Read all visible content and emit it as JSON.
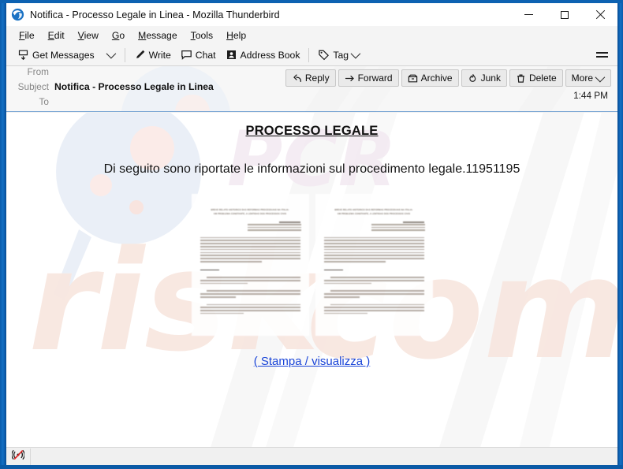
{
  "window": {
    "title": "Notifica - Processo Legale in Linea - Mozilla Thunderbird",
    "app_icon": "thunderbird-icon",
    "controls": {
      "minimize": "minimize-icon",
      "maximize": "maximize-icon",
      "close": "close-icon"
    },
    "frame_color": "#0d62b2"
  },
  "menubar": {
    "items": [
      {
        "label": "File",
        "accel": "F"
      },
      {
        "label": "Edit",
        "accel": "E"
      },
      {
        "label": "View",
        "accel": "V"
      },
      {
        "label": "Go",
        "accel": "G"
      },
      {
        "label": "Message",
        "accel": "M"
      },
      {
        "label": "Tools",
        "accel": "T"
      },
      {
        "label": "Help",
        "accel": "H"
      }
    ]
  },
  "toolbar": {
    "get_messages_label": "Get Messages",
    "get_messages_icon": "inbox-download-icon",
    "write_label": "Write",
    "write_icon": "pencil-icon",
    "chat_label": "Chat",
    "chat_icon": "speech-bubble-icon",
    "address_book_label": "Address Book",
    "address_book_icon": "contact-card-icon",
    "tag_label": "Tag",
    "tag_icon": "tag-icon",
    "app_menu_icon": "hamburger-menu-icon"
  },
  "message_header": {
    "fields": [
      {
        "label": "From",
        "value": ""
      },
      {
        "label": "Subject",
        "value": "Notifica - Processo Legale in Linea",
        "bold": true
      },
      {
        "label": "To",
        "value": ""
      }
    ],
    "timestamp": "1:44 PM",
    "actions": [
      {
        "label": "Reply",
        "icon": "reply-arrow-icon"
      },
      {
        "label": "Forward",
        "icon": "forward-arrow-icon"
      },
      {
        "label": "Archive",
        "icon": "archive-box-icon"
      },
      {
        "label": "Junk",
        "icon": "flame-icon"
      },
      {
        "label": "Delete",
        "icon": "trash-icon"
      },
      {
        "label": "More",
        "icon": "chevron-down-icon"
      }
    ]
  },
  "message_body": {
    "heading": "PROCESSO LEGALE",
    "paragraph": "Di seguito sono riportate le informazioni sul procedimento legale.11951195",
    "link_label": "( Stampa / visualizza )",
    "link_color": "#1a45d8",
    "attachments": [
      {
        "name": "document-preview-1",
        "alt": "blurred legal document page preview"
      },
      {
        "name": "document-preview-2",
        "alt": "blurred legal document page preview"
      }
    ],
    "watermarks": [
      {
        "text": "risk",
        "color": "#f7e5dd"
      },
      {
        "text": "com",
        "color": "#f7e5dd"
      },
      {
        "text": "PCR",
        "color": "#f4eaf0"
      }
    ]
  },
  "statusbar": {
    "offline_icon": "offline-indicator-icon"
  }
}
